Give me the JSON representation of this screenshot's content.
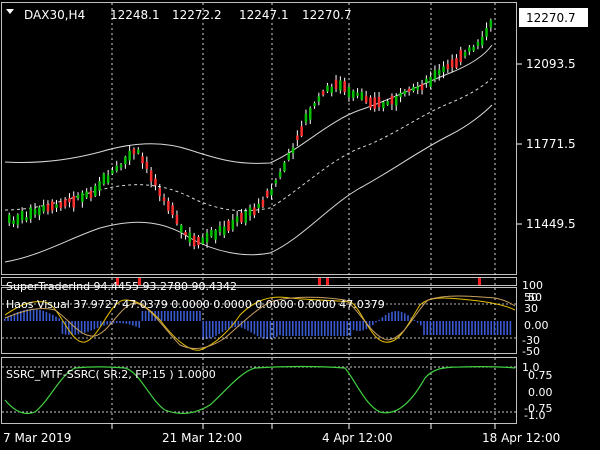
{
  "header": {
    "symbol": "DAX30,H4",
    "open": "12248.1",
    "high": "12272.2",
    "low": "12247.1",
    "close": "12270.7"
  },
  "price_axis": {
    "current_price": "12270.7",
    "ticks": [
      "12093.5",
      "11771.5",
      "11449.5"
    ]
  },
  "indicators": [
    {
      "name": "SuperTraderInd",
      "line": "SuperTraderInd 94.4455 93.2780 90.4342",
      "axis": [
        "100",
        "50"
      ]
    },
    {
      "name": "Haos Visual",
      "line": "Haos Visual 37.9727 47.0379 0.0000 0.0000 0.0000 0.0000 47.0379",
      "axis": [
        "50",
        "30",
        "0.00",
        "-30",
        "-50"
      ]
    },
    {
      "name": "SSRC_MTF",
      "line": "SSRC_MTF-SSRC( SR:2, FP:15 ) 1.0000",
      "axis": [
        "1.0",
        "0.75",
        "0.00",
        "-0.75",
        "-1.0"
      ]
    }
  ],
  "time_axis": {
    "labels": [
      "7 Mar 2019",
      "21 Mar 12:00",
      "4 Apr 12:00",
      "18 Apr 12:00"
    ]
  },
  "chart_data": {
    "type": "candlestick",
    "series_main": [
      {
        "name": "DAX30,H4",
        "close_last": 12270.7
      },
      {
        "name": "envelope-upper"
      },
      {
        "name": "envelope-middle"
      },
      {
        "name": "envelope-lower"
      }
    ],
    "price_range": [
      11300,
      12330
    ],
    "colors": {
      "bull": "#00c000",
      "bear": "#ff3030",
      "wick": "#ffffff",
      "bands": "#d8d8d8",
      "haos_hist": "#3a5bd0",
      "haos_line1": "#e8c000",
      "haos_line2": "#c8a060",
      "ssrc_line": "#40d040",
      "ssrc_dots": "#ffffff"
    }
  }
}
